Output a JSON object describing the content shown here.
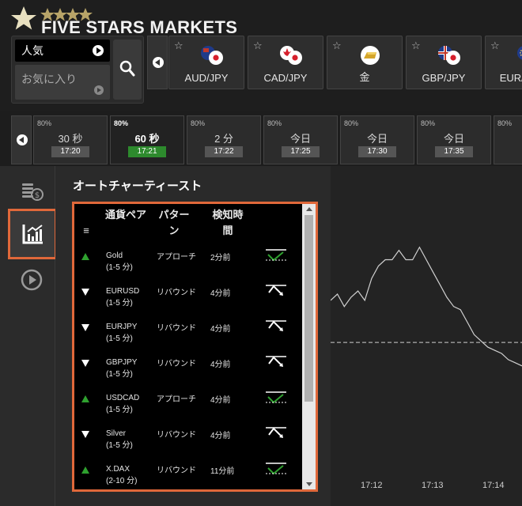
{
  "brand": {
    "logo_text": "FIVE STARS MARKETS"
  },
  "favorites": {
    "popular_tab": "人気",
    "favorites_tab": "お気に入り"
  },
  "assets": [
    {
      "label": "AUD/JPY",
      "icon": "aud-jpy-flag-icon"
    },
    {
      "label": "CAD/JPY",
      "icon": "cad-jpy-flag-icon"
    },
    {
      "label": "金",
      "icon": "gold-bar-icon"
    },
    {
      "label": "GBP/JPY",
      "icon": "gbp-jpy-flag-icon"
    },
    {
      "label": "EUR/USD",
      "icon": "eur-usd-flag-icon"
    }
  ],
  "durations": [
    {
      "pct": "80%",
      "name": "30 秒",
      "time": "17:20",
      "active": false
    },
    {
      "pct": "80%",
      "name": "60 秒",
      "time": "17:21",
      "active": true
    },
    {
      "pct": "80%",
      "name": "2 分",
      "time": "17:22",
      "active": false
    },
    {
      "pct": "80%",
      "name": "今日",
      "time": "17:25",
      "active": false
    },
    {
      "pct": "80%",
      "name": "今日",
      "time": "17:30",
      "active": false
    },
    {
      "pct": "80%",
      "name": "今日",
      "time": "17:35",
      "active": false
    },
    {
      "pct": "80%",
      "name": "",
      "time": "",
      "active": false
    }
  ],
  "panel": {
    "title": "オートチャーティースト",
    "headers": {
      "menu": "≡",
      "pair": "通貨ペア",
      "pattern": "パターン",
      "detected": "検知時間"
    },
    "rows": [
      {
        "dir": "up",
        "symbol": "Gold",
        "period": "(1-5 分)",
        "pattern": "アプローチ",
        "ago": "2分前"
      },
      {
        "dir": "down",
        "symbol": "EURUSD",
        "period": "(1-5 分)",
        "pattern": "リバウンド",
        "ago": "4分前"
      },
      {
        "dir": "down",
        "symbol": "EURJPY",
        "period": "(1-5 分)",
        "pattern": "リバウンド",
        "ago": "4分前"
      },
      {
        "dir": "down",
        "symbol": "GBPJPY",
        "period": "(1-5 分)",
        "pattern": "リバウンド",
        "ago": "4分前"
      },
      {
        "dir": "up",
        "symbol": "USDCAD",
        "period": "(1-5 分)",
        "pattern": "アプローチ",
        "ago": "4分前"
      },
      {
        "dir": "down",
        "symbol": "Silver",
        "period": "(1-5 分)",
        "pattern": "リバウンド",
        "ago": "4分前"
      },
      {
        "dir": "up",
        "symbol": "X.DAX",
        "period": "(2-10 分)",
        "pattern": "リバウンド",
        "ago": "11分前"
      }
    ]
  },
  "chart_data": {
    "type": "line",
    "x_ticks": [
      "17:12",
      "17:13",
      "17:14"
    ],
    "series": [
      {
        "values": [
          0.57,
          0.59,
          0.55,
          0.58,
          0.6,
          0.57,
          0.64,
          0.68,
          0.7,
          0.7,
          0.73,
          0.7,
          0.7,
          0.74,
          0.7,
          0.66,
          0.62,
          0.58,
          0.55,
          0.54,
          0.5,
          0.46,
          0.44,
          0.42,
          0.41,
          0.4,
          0.38,
          0.37,
          0.36
        ]
      }
    ],
    "reference_level": 0.435,
    "colors": {
      "line": "#d0d0d0",
      "reference": "#cfcfcf",
      "background": "#232323"
    }
  },
  "colors": {
    "highlight": "#e0683a",
    "active_time": "#2d8a2d",
    "up": "#2fa12f",
    "down": "#ffffff"
  }
}
